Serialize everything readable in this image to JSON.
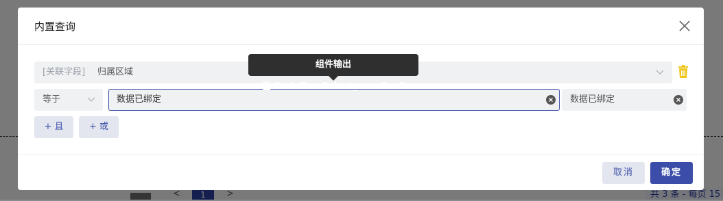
{
  "background": {
    "pagination": {
      "prev_symbol": "<",
      "current_page": "1",
      "next_symbol": ">",
      "total": "共 3 条 - 每页 15"
    }
  },
  "modal": {
    "title": "内置查询",
    "close_icon": "close-icon",
    "condition": {
      "field_prefix": "[关联字段]",
      "field_value": "归属区域",
      "tooltip": "组件输出值:NodeTreeSelect_eaae8ec8",
      "operator": "等于",
      "value_input": "数据已绑定",
      "output_value": "数据已绑定"
    },
    "add_and_label": "+ 且",
    "add_or_label": "+ 或",
    "cancel_label": "取消",
    "ok_label": "确定"
  },
  "colors": {
    "primary": "#3b4da8",
    "trash": "#f0c419",
    "tooltip_bg": "#2f2f2f"
  }
}
